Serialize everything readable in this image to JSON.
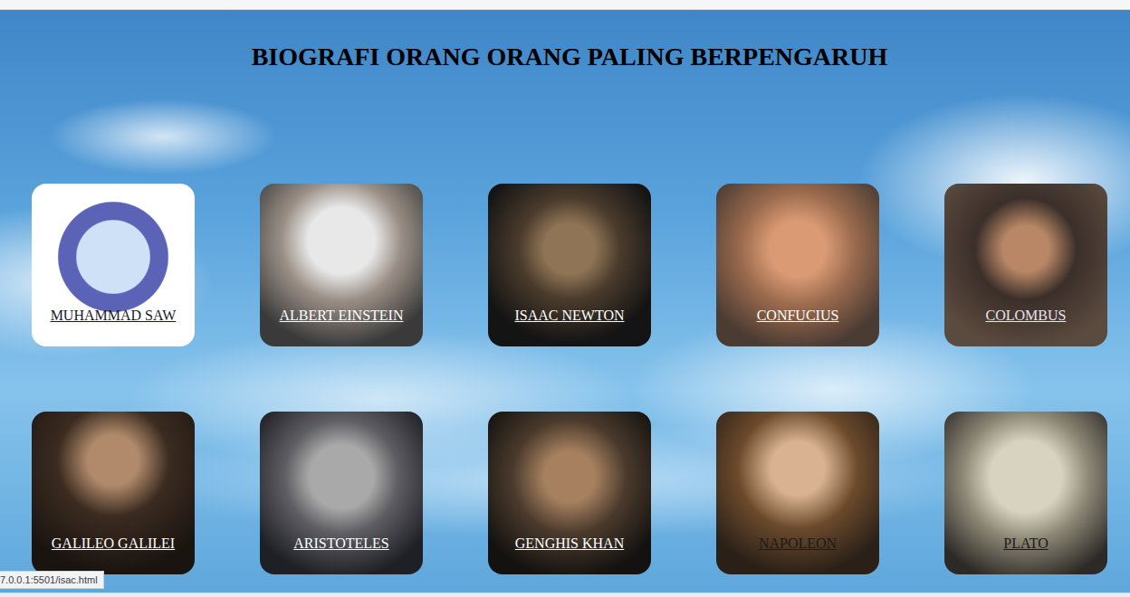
{
  "title": "BIOGRAFI ORANG ORANG PALING BERPENGARUH",
  "cards": [
    {
      "name": "MUHAMMAD SAW",
      "color": "#1a1a2e"
    },
    {
      "name": "ALBERT EINSTEIN",
      "color": "#ffffff"
    },
    {
      "name": "ISAAC NEWTON",
      "color": "#ffffff"
    },
    {
      "name": "CONFUCIUS",
      "color": "#ffffff"
    },
    {
      "name": "COLOMBUS",
      "color": "#e8e4f4"
    },
    {
      "name": "GALILEO GALILEI",
      "color": "#ffffff"
    },
    {
      "name": "ARISTOTELES",
      "color": "#ffffff"
    },
    {
      "name": "GENGHIS KHAN",
      "color": "#ffffff"
    },
    {
      "name": "NAPOLEON",
      "color": "#1a1a1a"
    },
    {
      "name": "PLATO",
      "color": "#1a1a1a"
    }
  ],
  "status_link": "7.0.0.1:5501/isac.html"
}
